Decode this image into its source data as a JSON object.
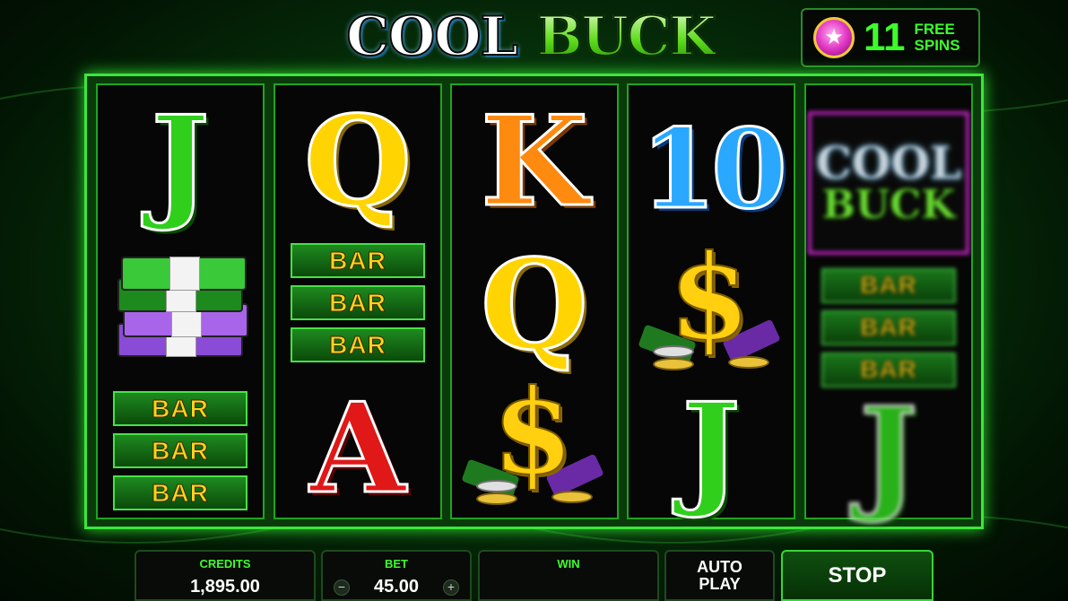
{
  "title": {
    "word1": "COOL",
    "word2": "BUCK"
  },
  "free_spins": {
    "count": "11",
    "label_line1": "FREE",
    "label_line2": "SPINS",
    "icon": "star-coin-icon"
  },
  "reels": {
    "reel1": {
      "top": "J",
      "middle": "cash-stack",
      "bottom": [
        "BAR",
        "BAR",
        "BAR"
      ]
    },
    "reel2": {
      "top": "Q",
      "middle": [
        "BAR",
        "BAR",
        "BAR"
      ],
      "bottom": "A"
    },
    "reel3": {
      "top": "K",
      "middle": "Q",
      "bottom": "$"
    },
    "reel4": {
      "top": "10",
      "middle": "$",
      "bottom": "J"
    },
    "reel5": {
      "top_word1": "COOL",
      "top_word2": "BUCK",
      "middle": [
        "BAR",
        "BAR",
        "BAR"
      ],
      "bottom": "J"
    }
  },
  "panel": {
    "credits_label": "CREDITS",
    "credits_value": "1,895.00",
    "bet_label": "BET",
    "bet_value": "45.00",
    "bet_minus": "−",
    "bet_plus": "+",
    "win_label": "WIN",
    "win_value": "",
    "autoplay_line1": "AUTO",
    "autoplay_line2": "PLAY",
    "stop_label": "STOP"
  },
  "colors": {
    "accent": "#3cff2a",
    "frame": "#3ce63c",
    "bar_text": "#ffd31a"
  }
}
